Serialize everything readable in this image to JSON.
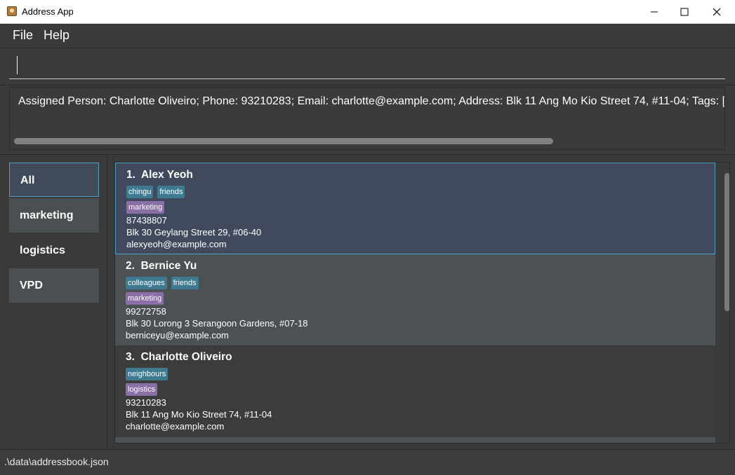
{
  "window": {
    "title": "Address App",
    "controls": [
      "minimize-icon",
      "maximize-icon",
      "close-icon"
    ]
  },
  "menu": {
    "file": "File",
    "help": "Help"
  },
  "command": {
    "value": ""
  },
  "result": {
    "text": "Assigned Person: Charlotte Oliveiro; Phone: 93210283; Email: charlotte@example.com; Address: Blk 11 Ang Mo Kio Street 74, #11-04; Tags: ["
  },
  "groups": [
    "All",
    "marketing",
    "logistics",
    "VPD"
  ],
  "persons": [
    {
      "index": "1.",
      "name": "Alex Yeoh",
      "tags": [
        "chingu",
        "friends"
      ],
      "groups": [
        "marketing"
      ],
      "phone": "87438807",
      "address": "Blk 30 Geylang Street 29, #06-40",
      "email": "alexyeoh@example.com"
    },
    {
      "index": "2.",
      "name": "Bernice Yu",
      "tags": [
        "colleagues",
        "friends"
      ],
      "groups": [
        "marketing"
      ],
      "phone": "99272758",
      "address": "Blk 30 Lorong 3 Serangoon Gardens, #07-18",
      "email": "berniceyu@example.com"
    },
    {
      "index": "3.",
      "name": "Charlotte Oliveiro",
      "tags": [
        "neighbours"
      ],
      "groups": [
        "logistics"
      ],
      "phone": "93210283",
      "address": "Blk 11 Ang Mo Kio Street 74, #11-04",
      "email": "charlotte@example.com"
    }
  ],
  "status": {
    "file_path": ".\\data\\addressbook.json"
  },
  "colors": {
    "selected_card": "#414a5d",
    "selected_border": "#4f9fc3",
    "tag_blue": "#3e7b91",
    "tag_purple": "#8a6fa6"
  }
}
